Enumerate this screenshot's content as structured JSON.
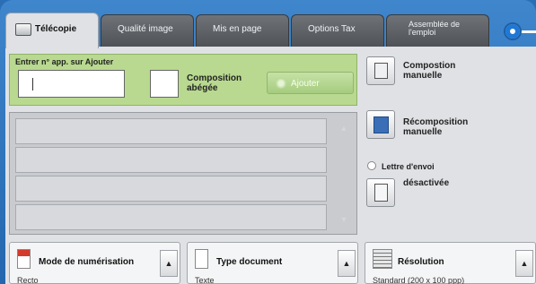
{
  "tabs": [
    {
      "label": "Télécopie",
      "active": true
    },
    {
      "label": "Qualité image",
      "active": false
    },
    {
      "label": "Mis en page",
      "active": false
    },
    {
      "label": "Options Tax",
      "active": false
    },
    {
      "label": "Assemblée de l'emploi",
      "active": false
    }
  ],
  "entry": {
    "label": "Entrer n° app. sur Ajouter",
    "value": "",
    "checkbox_label": "Composition abégée",
    "add_label": "Ajouter"
  },
  "right": {
    "compose_manual": "Compostion manuelle",
    "recompose_manual": "Récomposition manuelle",
    "cover_letter_title": "Lettre d'envoi",
    "cover_letter_value": "désactivée"
  },
  "bottom": [
    {
      "title": "Mode de numérisation",
      "value": "Recto"
    },
    {
      "title": "Type document",
      "value": "Texte"
    },
    {
      "title": "Résolution",
      "value": "Standard (200 x 100 ppp)"
    }
  ],
  "colors": {
    "accent": "#2466ad",
    "green": "#b8d98f"
  }
}
